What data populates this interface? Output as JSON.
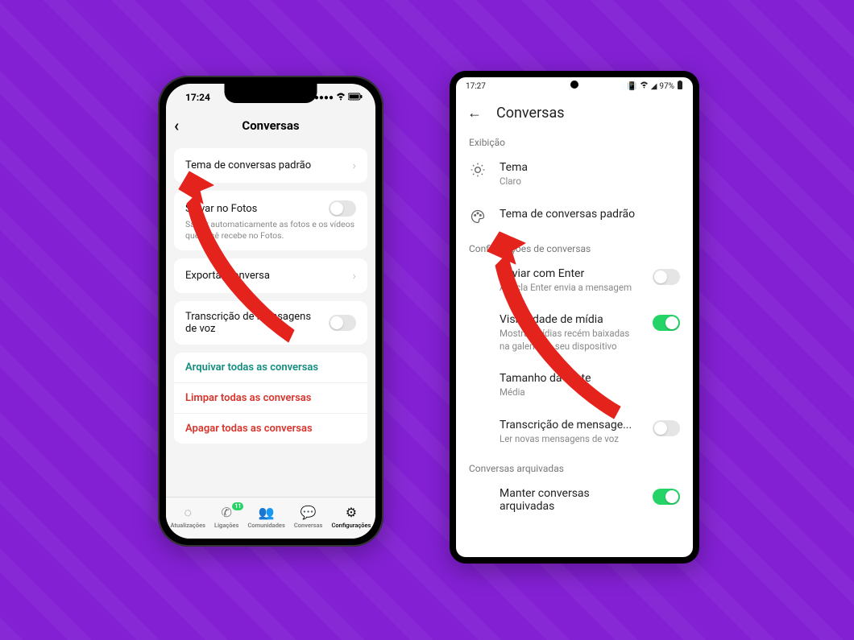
{
  "ios": {
    "status_time": "17:24",
    "header_title": "Conversas",
    "rows": {
      "default_theme": "Tema de conversas padrão",
      "save_photos_title": "Salvar no Fotos",
      "save_photos_desc": "Salvar automaticamente as fotos e os vídeos que você recebe no Fotos.",
      "export": "Exportar conversa",
      "transcription": "Transcrição de mensagens de voz"
    },
    "actions": {
      "archive": "Arquivar todas as conversas",
      "clear": "Limpar todas as conversas",
      "delete": "Apagar todas as conversas"
    },
    "tabs": {
      "updates": "Atualizações",
      "calls": "Ligações",
      "calls_badge": "11",
      "communities": "Comunidades",
      "chats": "Conversas",
      "settings": "Configurações"
    }
  },
  "android": {
    "status_time": "17:27",
    "status_battery": "97%",
    "header_title": "Conversas",
    "section_display": "Exibição",
    "theme_title": "Tema",
    "theme_value": "Claro",
    "default_theme": "Tema de conversas padrão",
    "section_chat": "Configurações de conversas",
    "enter_title": "Enviar com Enter",
    "enter_desc": "A tecla Enter envia a mensagem",
    "media_title": "Visibilidade de mídia",
    "media_desc": "Mostrar mídias recém baixadas na galeria do seu dispositivo",
    "font_title": "Tamanho da fonte",
    "font_value": "Média",
    "transcription_title": "Transcrição de mensage...",
    "transcription_desc": "Ler novas mensagens de voz",
    "section_archived": "Conversas arquivadas",
    "keep_archived": "Manter conversas arquivadas"
  }
}
